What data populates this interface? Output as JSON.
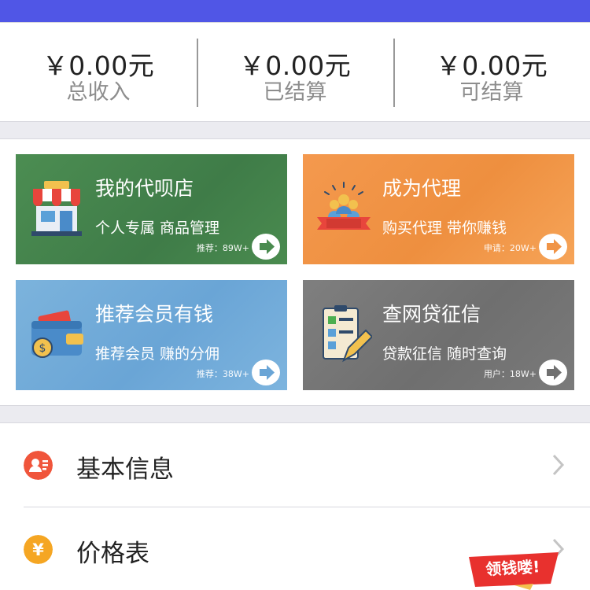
{
  "stats": [
    {
      "amount": "￥0.00元",
      "label": "总收入"
    },
    {
      "amount": "￥0.00元",
      "label": "已结算"
    },
    {
      "amount": "￥0.00元",
      "label": "可结算"
    }
  ],
  "cards": [
    {
      "title": "我的代呗店",
      "subtitle": "个人专属 商品管理",
      "count": "推荐：89W+",
      "icon": "storefront-icon"
    },
    {
      "title": "成为代理",
      "subtitle": "购买代理 带你赚钱",
      "count": "申请：20W+",
      "icon": "agent-team-icon"
    },
    {
      "title": "推荐会员有钱",
      "subtitle": "推荐会员 赚的分佣",
      "count": "推荐：38W+",
      "icon": "wallet-icon"
    },
    {
      "title": "查网贷征信",
      "subtitle": "贷款征信 随时查询",
      "count": "用户：18W+",
      "icon": "credit-report-icon"
    }
  ],
  "menu": [
    {
      "label": "基本信息",
      "icon": "profile-card-icon",
      "color": "#f0553b"
    },
    {
      "label": "价格表",
      "icon": "yuan-icon",
      "color": "#f5a623"
    }
  ],
  "promo": {
    "text": "领钱喽!"
  },
  "colors": {
    "topbar": "#5056e6",
    "accent_red": "#e8312e"
  }
}
